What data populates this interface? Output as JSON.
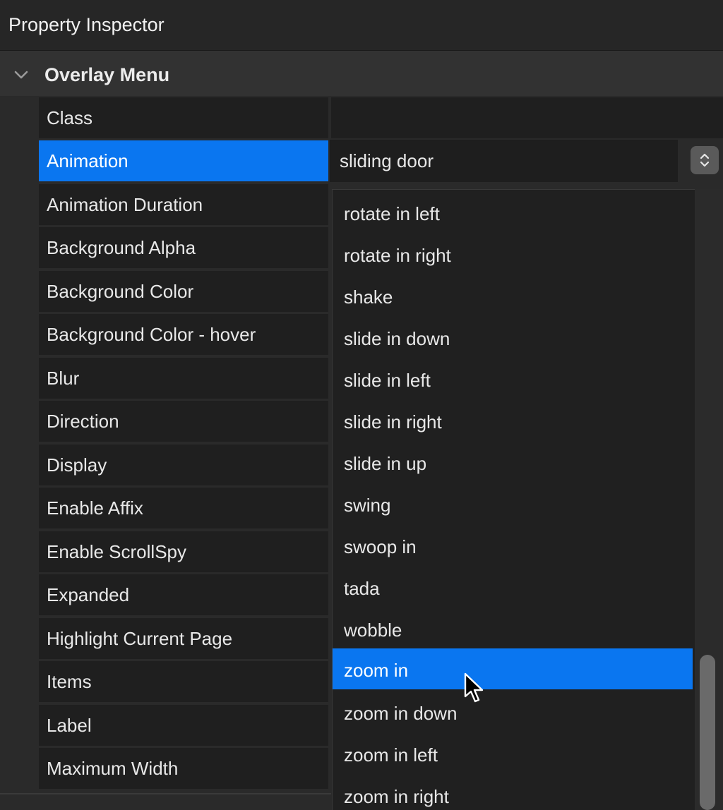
{
  "panel": {
    "title": "Property Inspector",
    "section_title": "Overlay Menu"
  },
  "properties": [
    {
      "label": "Class"
    },
    {
      "label": "Animation",
      "value": "sliding door",
      "selected": true
    },
    {
      "label": "Animation Duration"
    },
    {
      "label": "Background Alpha"
    },
    {
      "label": "Background Color"
    },
    {
      "label": "Background Color - hover"
    },
    {
      "label": "Blur"
    },
    {
      "label": "Direction"
    },
    {
      "label": "Display"
    },
    {
      "label": "Enable Affix"
    },
    {
      "label": "Enable ScrollSpy"
    },
    {
      "label": "Expanded"
    },
    {
      "label": "Highlight Current Page"
    },
    {
      "label": "Items"
    },
    {
      "label": "Label"
    },
    {
      "label": "Maximum Width"
    }
  ],
  "animation_dropdown": {
    "options": [
      "rotate in left",
      "rotate in right",
      "shake",
      "slide in down",
      "slide in left",
      "slide in right",
      "slide in up",
      "swing",
      "swoop in",
      "tada",
      "wobble",
      "zoom in",
      "zoom in down",
      "zoom in left",
      "zoom in right"
    ],
    "highlighted": "zoom in"
  },
  "colors": {
    "selection": "#0a76f0",
    "background": "#2a2a2a",
    "row": "#1f1f1f"
  },
  "icons": {
    "section_toggle": "chevron-down-icon",
    "stepper": "up-down-stepper-icon",
    "cursor": "mouse-pointer-icon"
  }
}
